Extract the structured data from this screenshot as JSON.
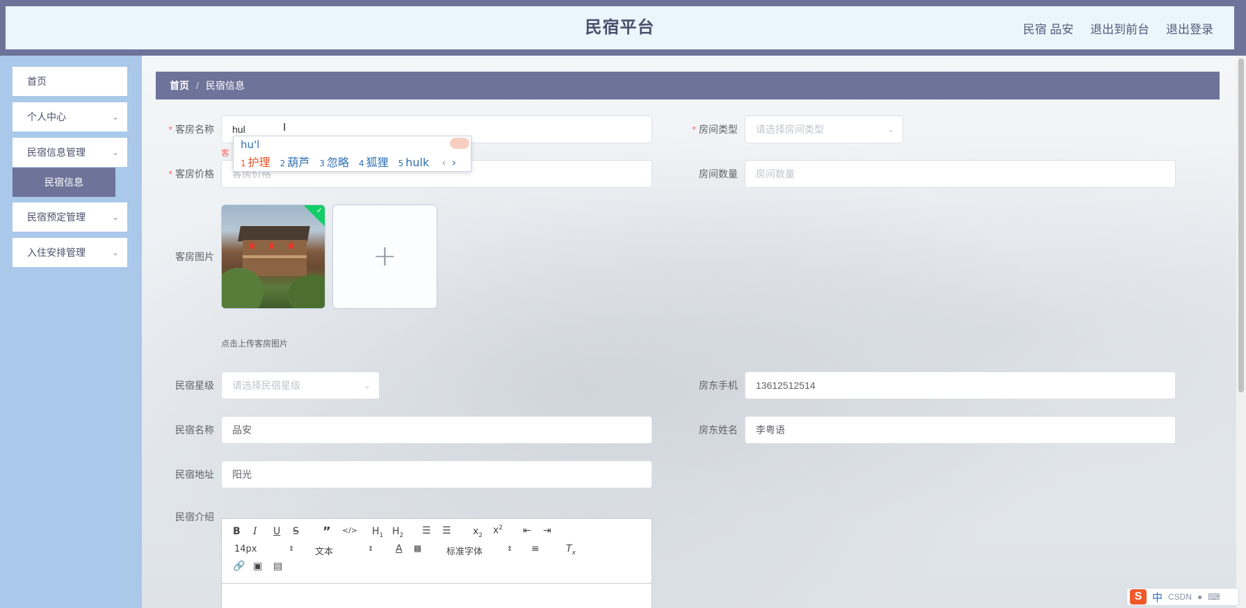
{
  "header": {
    "title": "民宿平台",
    "links": [
      "民宿 品安",
      "退出到前台",
      "退出登录"
    ]
  },
  "sidebar": {
    "items": [
      {
        "label": "首页",
        "has_children": false
      },
      {
        "label": "个人中心",
        "has_children": true
      },
      {
        "label": "民宿信息管理",
        "has_children": true
      },
      {
        "label": "民宿信息",
        "active": true
      },
      {
        "label": "民宿预定管理",
        "has_children": true
      },
      {
        "label": "入住安排管理",
        "has_children": true
      }
    ]
  },
  "breadcrumb": {
    "home": "首页",
    "separator": "/",
    "current": "民宿信息"
  },
  "form": {
    "room_name": {
      "label": "客房名称",
      "value": "hul",
      "required": true
    },
    "room_name_error": "客",
    "room_type": {
      "label": "房间类型",
      "placeholder": "请选择房间类型",
      "required": true
    },
    "room_price": {
      "label": "客房价格",
      "placeholder": "客房价格",
      "required": true
    },
    "room_count": {
      "label": "房间数量",
      "placeholder": "房间数量"
    },
    "room_image": {
      "label": "客房图片",
      "tip": "点击上传客房图片",
      "add_symbol": "+"
    },
    "star": {
      "label": "民宿星级",
      "placeholder": "请选择民宿星级"
    },
    "host_phone": {
      "label": "房东手机",
      "value": "13612512514"
    },
    "bnb_name": {
      "label": "民宿名称",
      "value": "品安"
    },
    "host_name": {
      "label": "房东姓名",
      "value": "李粤语"
    },
    "bnb_address": {
      "label": "民宿地址",
      "value": "阳光"
    },
    "bnb_intro": {
      "label": "民宿介绍"
    }
  },
  "ime": {
    "composition": "hu'l",
    "candidates": [
      {
        "n": "1",
        "text": "护理"
      },
      {
        "n": "2",
        "text": "葫芦"
      },
      {
        "n": "3",
        "text": "忽略"
      },
      {
        "n": "4",
        "text": "狐狸"
      },
      {
        "n": "5",
        "text": "hulk"
      }
    ],
    "prev": "‹",
    "next": "›"
  },
  "editor": {
    "font_size": "14px",
    "block_type": "文本",
    "font_family": "标准字体"
  },
  "taskbar_ime": {
    "logo": "S",
    "mode": "中",
    "tray": "CSDN"
  },
  "colors": {
    "accent": "#6e7399",
    "sidebar": "#a9c8ea",
    "error": "#f56c6c",
    "success": "#13ce66"
  }
}
